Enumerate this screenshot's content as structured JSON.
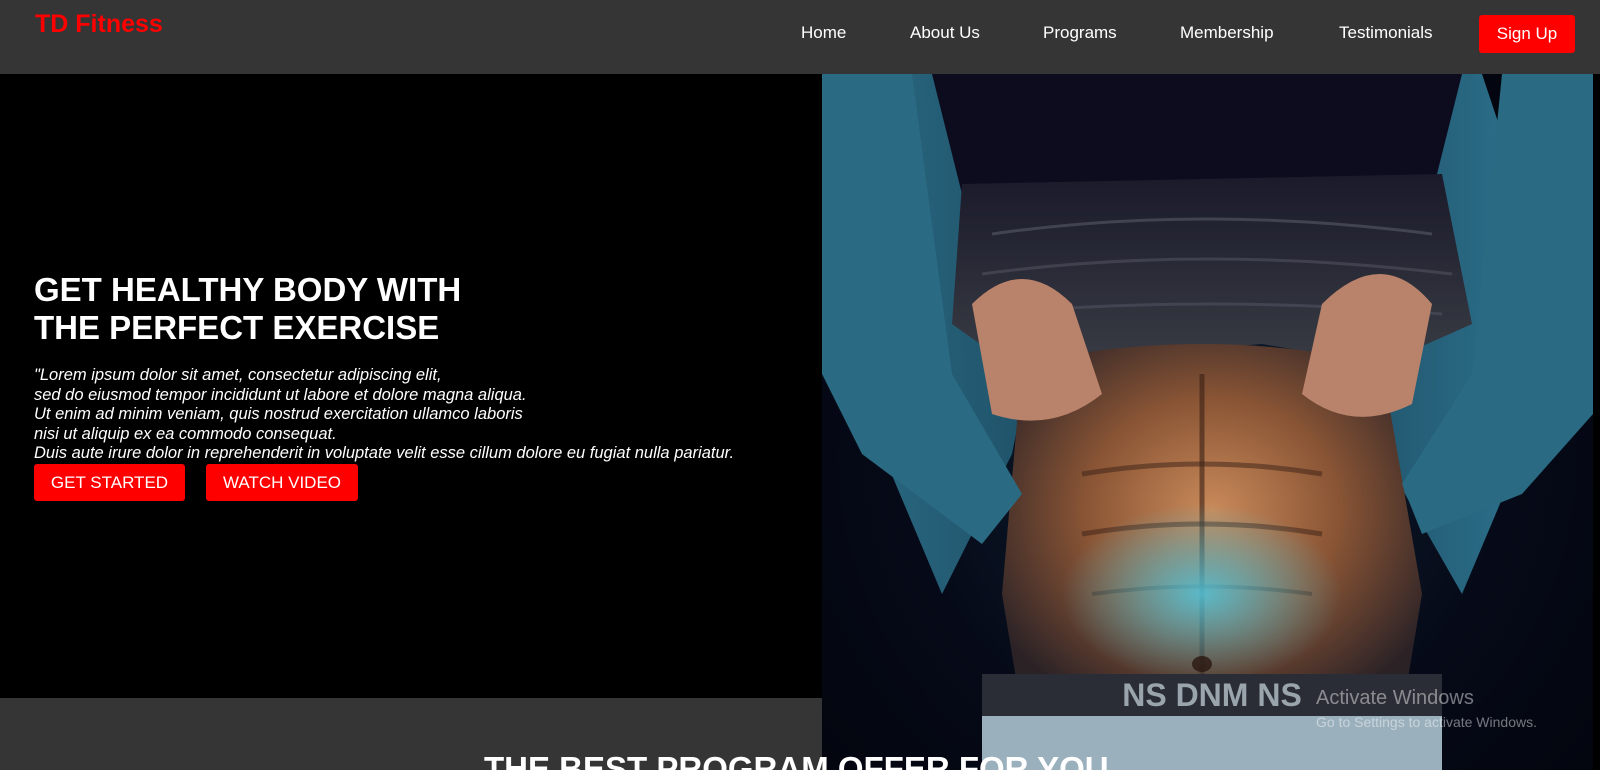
{
  "nav": {
    "logo": "TD Fitness",
    "links": [
      "Home",
      "About Us",
      "Programs",
      "Membership",
      "Testimonials"
    ],
    "signup": "Sign Up"
  },
  "hero": {
    "title_line1": "GET HEALTHY BODY WITH",
    "title_line2": "THE PERFECT EXERCISE",
    "text_lines": [
      "\"Lorem ipsum dolor sit amet, consectetur adipiscing elit,",
      "sed do eiusmod tempor incididunt ut labore et dolore magna aliqua.",
      "Ut enim ad minim veniam, quis nostrud exercitation ullamco laboris",
      "nisi ut aliquip ex ea commodo consequat.",
      "Duis aute irure dolor in reprehenderit in voluptate velit esse cillum dolore eu fugiat nulla pariatur."
    ],
    "btn_get_started": "GET STARTED",
    "btn_watch_video": "WATCH VIDEO",
    "waistband_text": "NS DNM NS"
  },
  "section": {
    "title": "THE BEST PROGRAM OFFER FOR YOU"
  },
  "watermark": {
    "title": "Activate Windows",
    "subtitle": "Go to Settings to activate Windows."
  },
  "colors": {
    "accent": "#ff0000",
    "navbar": "#353535",
    "background": "#000000"
  }
}
